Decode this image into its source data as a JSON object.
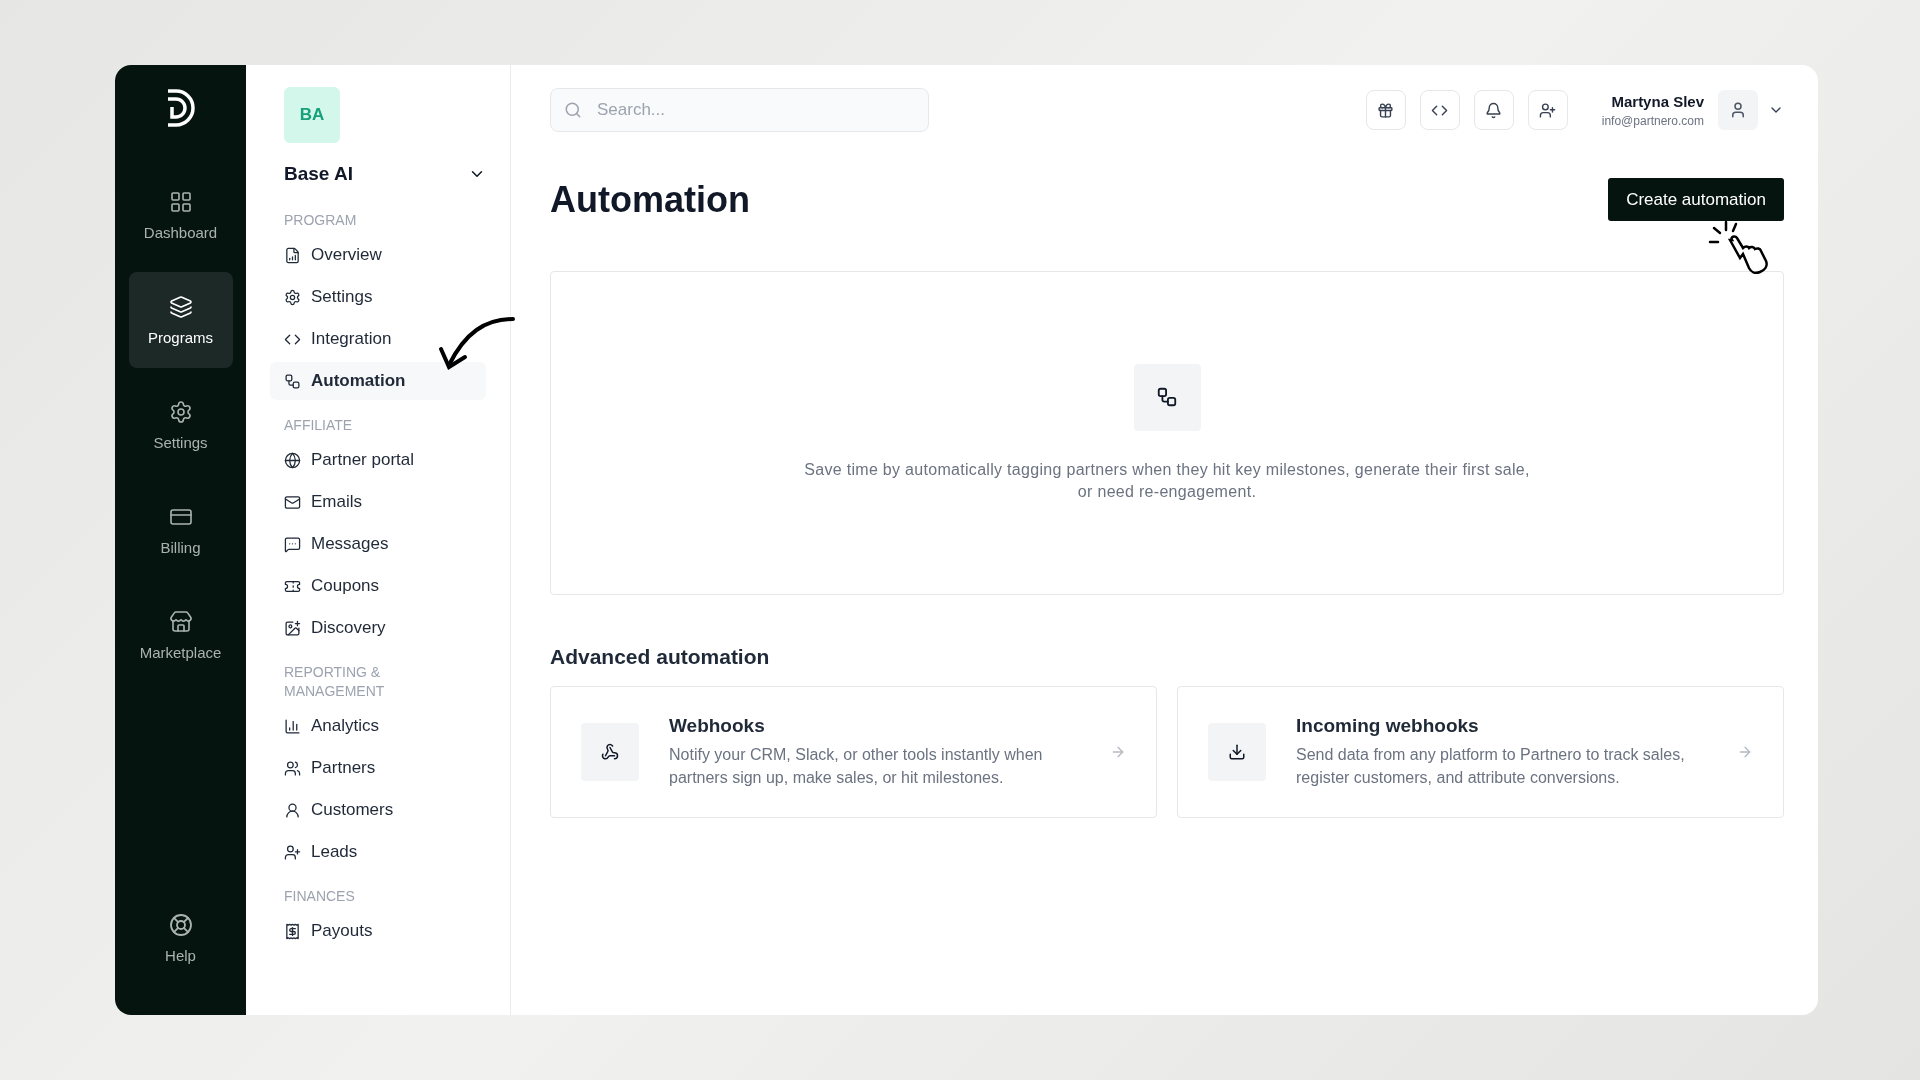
{
  "rail": {
    "items": [
      {
        "label": "Dashboard",
        "selected": false
      },
      {
        "label": "Programs",
        "selected": true
      },
      {
        "label": "Settings",
        "selected": false
      },
      {
        "label": "Billing",
        "selected": false
      },
      {
        "label": "Marketplace",
        "selected": false
      }
    ],
    "help": {
      "label": "Help"
    }
  },
  "sidebar": {
    "badge": "BA",
    "program_name": "Base AI",
    "sections": [
      {
        "title": "PROGRAM",
        "items": [
          {
            "label": "Overview",
            "selected": false
          },
          {
            "label": "Settings",
            "selected": false
          },
          {
            "label": "Integration",
            "selected": false
          },
          {
            "label": "Automation",
            "selected": true
          }
        ]
      },
      {
        "title": "AFFILIATE",
        "items": [
          {
            "label": "Partner portal",
            "selected": false
          },
          {
            "label": "Emails",
            "selected": false
          },
          {
            "label": "Messages",
            "selected": false
          },
          {
            "label": "Coupons",
            "selected": false
          },
          {
            "label": "Discovery",
            "selected": false
          }
        ]
      },
      {
        "title": "REPORTING & MANAGEMENT",
        "items": [
          {
            "label": "Analytics",
            "selected": false
          },
          {
            "label": "Partners",
            "selected": false
          },
          {
            "label": "Customers",
            "selected": false
          },
          {
            "label": "Leads",
            "selected": false
          }
        ]
      },
      {
        "title": "FINANCES",
        "items": [
          {
            "label": "Payouts",
            "selected": false
          }
        ]
      }
    ]
  },
  "topbar": {
    "search": {
      "placeholder": "Search..."
    },
    "user": {
      "name": "Martyna Slev",
      "email": "info@partnero.com"
    }
  },
  "page": {
    "title": "Automation",
    "primary_button": "Create automation",
    "empty_state": {
      "text": "Save time by automatically tagging partners when they hit key milestones, generate their first sale, or need re-engagement."
    },
    "advanced": {
      "title": "Advanced automation",
      "cards": [
        {
          "kind": "webhook",
          "title": "Webhooks",
          "description": "Notify your CRM, Slack, or other tools instantly when partners sign up, make sales, or hit milestones."
        },
        {
          "kind": "incoming",
          "title": "Incoming webhooks",
          "description": "Send data from any platform to Partnero to track sales, register customers, and attribute conversions."
        }
      ]
    }
  }
}
